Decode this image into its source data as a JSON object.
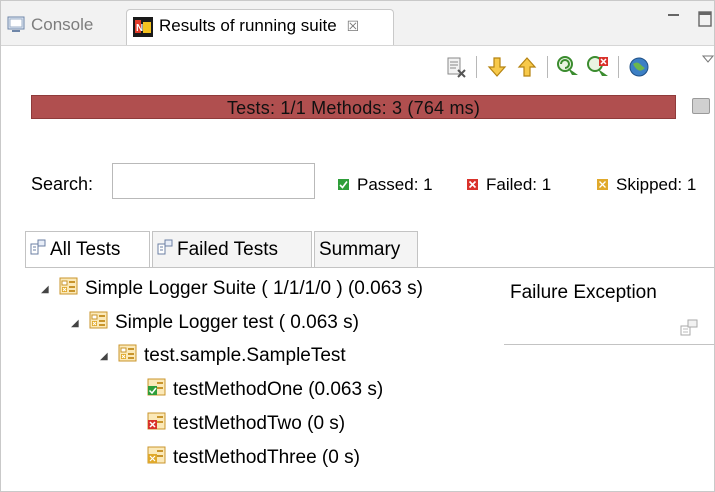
{
  "view_tabs": {
    "console": "Console",
    "results": "Results of running suite",
    "close_glyph": "☒"
  },
  "progress": {
    "text": "Tests: 1/1  Methods: 3 (764 ms)",
    "fraction": 1.0,
    "color": "#b04f4f"
  },
  "search": {
    "label": "Search:",
    "value": "",
    "placeholder": ""
  },
  "counters": {
    "passed": "Passed: 1",
    "failed": "Failed: 1",
    "skipped": "Skipped: 1"
  },
  "content_tabs": {
    "all_tests": "All Tests",
    "failed_tests": "Failed Tests",
    "summary": "Summary"
  },
  "tree": {
    "suite": "Simple Logger Suite ( 1/1/1/0 ) (0.063 s)",
    "test": "Simple Logger test ( 0.063 s)",
    "class": "test.sample.SampleTest",
    "methods": [
      {
        "label": "testMethodOne  (0.063 s)",
        "status": "passed"
      },
      {
        "label": "testMethodTwo  (0 s)",
        "status": "failed"
      },
      {
        "label": "testMethodThree  (0 s)",
        "status": "skipped"
      }
    ]
  },
  "failure_panel": {
    "title": "Failure Exception"
  },
  "colors": {
    "passed": "#2f9e3a",
    "failed": "#d9322b",
    "skipped": "#e0a92b",
    "progress_failed": "#b04f4f"
  },
  "icons": [
    "console-icon",
    "testng-icon",
    "close-icon",
    "minimize-icon",
    "maximize-icon",
    "clear-results-icon",
    "next-failure-icon",
    "previous-failure-icon",
    "rerun-icon",
    "rerun-failed-icon",
    "globe-icon",
    "view-menu-icon"
  ]
}
